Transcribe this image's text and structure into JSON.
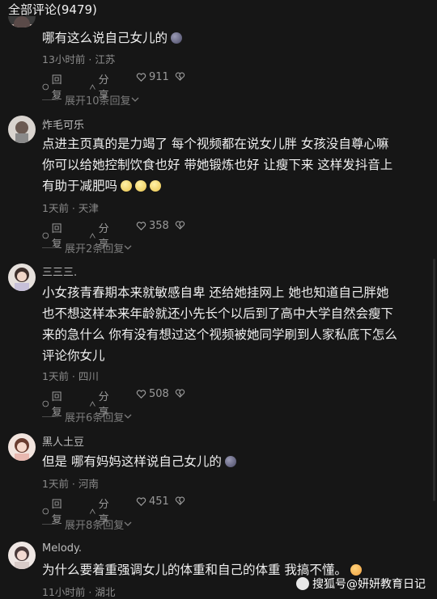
{
  "header": {
    "title": "全部评论(9479)"
  },
  "actions_labels": {
    "reply": "回复",
    "share": "分享"
  },
  "comments": [
    {
      "username": "",
      "lines": [
        "哪有这么说自己女儿的"
      ],
      "emoji": "ball",
      "meta": "13小时前 · 江苏",
      "likes": "911",
      "replies": "展开10条回复"
    },
    {
      "username": "炸毛可乐",
      "lines": [
        "点进主页真的是力竭了 每个视频都在说女儿胖 女孩没自尊心嘛",
        "你可以给她控制饮食也好 带她锻炼也好 让瘦下来 这样发抖音上",
        "有助于减肥吗"
      ],
      "emoji": "face3",
      "meta": "1天前 · 天津",
      "likes": "358",
      "replies": "展开2条回复"
    },
    {
      "username": "三三三.",
      "lines": [
        "小女孩青春期本来就敏感自卑 还给她挂网上 她也知道自己胖她",
        "也不想这样本来年龄就还小先长个以后到了高中大学自然会瘦下",
        "来的急什么 你有没有想过这个视频被她同学刷到人家私底下怎么",
        "评论你女儿"
      ],
      "emoji": "",
      "meta": "1天前 · 四川",
      "likes": "508",
      "replies": "展开6条回复"
    },
    {
      "username": "黑人土豆",
      "lines": [
        "但是 哪有妈妈这样说自己女儿的"
      ],
      "emoji": "ball",
      "meta": "1天前 · 河南",
      "likes": "451",
      "replies": "展开8条回复"
    },
    {
      "username": "Melody.",
      "lines": [
        "为什么要着重强调女儿的体重和自己的体重 我搞不懂。"
      ],
      "emoji": "blush",
      "meta": "11小时前 · 湖北",
      "likes": "",
      "replies": ""
    }
  ],
  "watermark": "搜狐号@妍妍教育日记"
}
